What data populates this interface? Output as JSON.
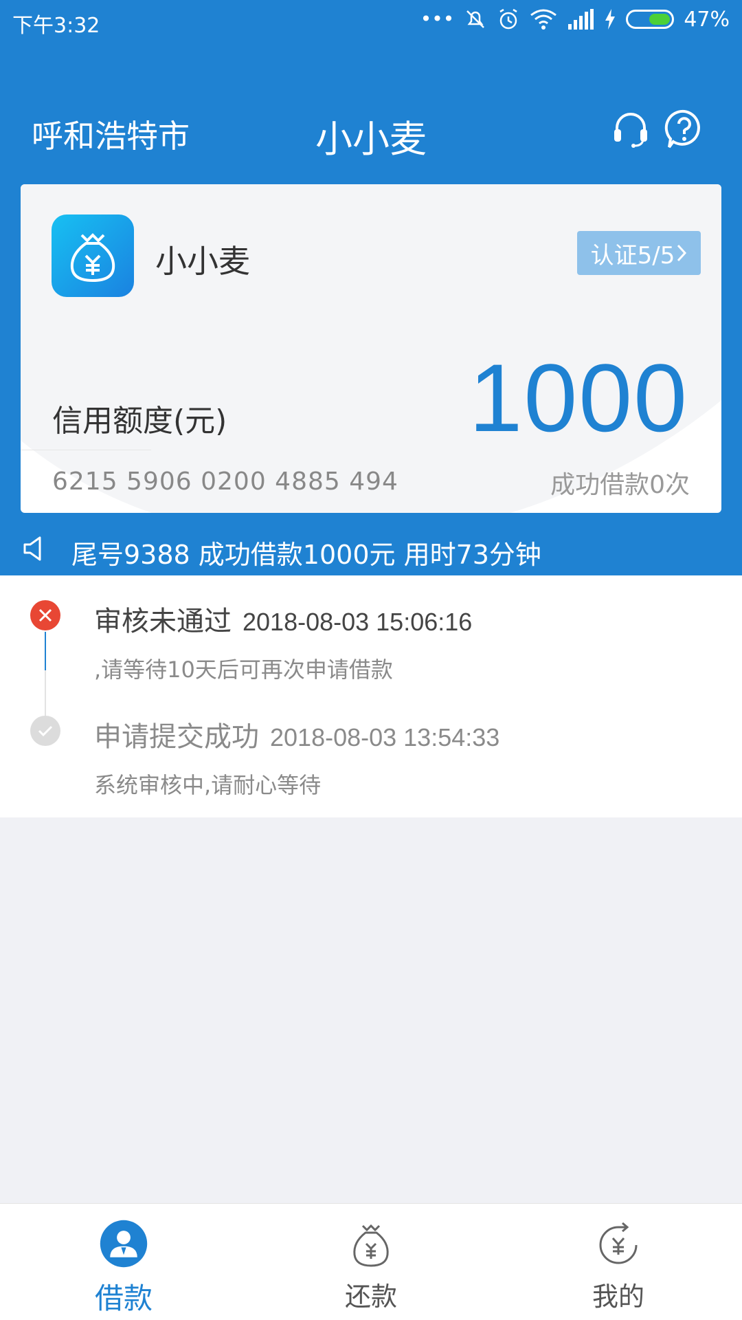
{
  "status_bar": {
    "time": "下午3:32",
    "battery": "47%",
    "battery_level": 0.47
  },
  "header": {
    "city": "呼和浩特市",
    "title": "小小麦",
    "icons": [
      "headset-icon",
      "help-icon"
    ]
  },
  "card": {
    "app_name": "小小麦",
    "verify_label": "认证5/5",
    "credit_label": "信用额度(元)",
    "credit_amount": "1000",
    "card_number": "6215 5906 0200 4885 494",
    "success_count": "成功借款0次"
  },
  "notice": {
    "text": "尾号9388 成功借款1000元 用时73分钟"
  },
  "timeline": [
    {
      "title": "审核未通过",
      "time": "2018-08-03 15:06:16",
      "desc": ",请等待10天后可再次申请借款",
      "status": "fail"
    },
    {
      "title": "申请提交成功",
      "time": "2018-08-03 13:54:33",
      "desc": "系统审核中,请耐心等待",
      "status": "done"
    }
  ],
  "tabs": [
    {
      "label": "借款",
      "icon": "person-icon",
      "active": true
    },
    {
      "label": "还款",
      "icon": "money-bag-icon",
      "active": false
    },
    {
      "label": "我的",
      "icon": "refresh-yen-icon",
      "active": false
    }
  ],
  "colors": {
    "primary": "#1f82d2",
    "fail": "#e84734",
    "verify_button": "#8ec1ea"
  }
}
